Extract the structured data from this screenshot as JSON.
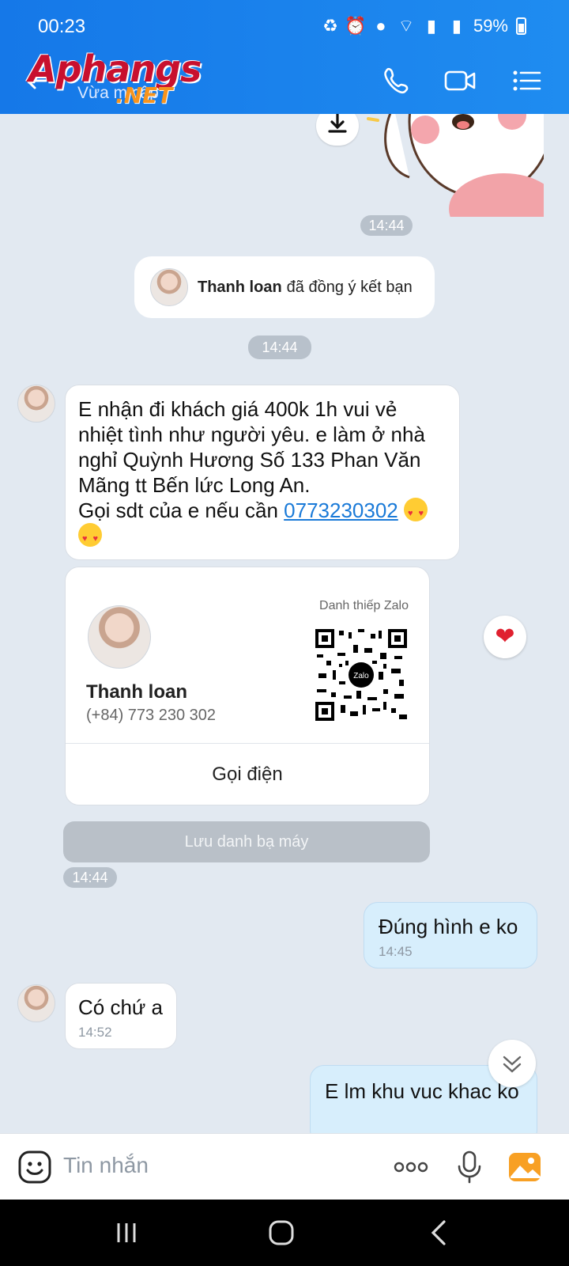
{
  "status_bar": {
    "time": "00:23",
    "battery": "59%"
  },
  "header": {
    "logo_main": "Aphangs",
    "logo_net": ".NET",
    "subtitle": "Vừa m   cập"
  },
  "chat": {
    "time_1": "14:44",
    "system_message": {
      "name": "Thanh loan",
      "text": "đã đồng ý kết bạn"
    },
    "time_2": "14:44",
    "incoming_1": {
      "line_1": "E   nhận đi khách giá 400k 1h vui vẻ",
      "line_2": "nhiệt tình như người yêu. e làm ở nhà",
      "line_3": "nghỉ Quỳnh Hương Số 133 Phan Văn",
      "line_4": "Mãng tt Bến lức Long An.",
      "line_5_prefix": "Gọi sdt của e nếu cần ",
      "phone_link": "0773230302"
    },
    "contact_card": {
      "label": "Danh thiếp Zalo",
      "name": "Thanh loan",
      "phone": "(+84) 773 230 302",
      "call_label": "Gọi điện",
      "qr_badge": "Zalo"
    },
    "save_contact_label": "Lưu danh bạ máy",
    "time_3": "14:44",
    "outgoing_1": {
      "text": "Đúng  hình e ko",
      "time": "14:45"
    },
    "incoming_2": {
      "text": "Có chứ a",
      "time": "14:52"
    },
    "outgoing_2": {
      "text": "E lm khu vuc khac ko"
    }
  },
  "input": {
    "placeholder": "Tin nhắn"
  },
  "icons": [
    "back-arrow-icon",
    "phone-icon",
    "video-icon",
    "menu-icon",
    "download-icon",
    "heart-icon",
    "chevron-down-icon",
    "sticker-icon",
    "more-icon",
    "mic-icon",
    "image-icon",
    "recents-icon",
    "home-icon",
    "nav-back-icon"
  ],
  "colors": {
    "header": "#1a82ec",
    "chat_bg": "#e2e9f1",
    "outgoing_bubble": "#d7eefc",
    "link": "#1a7ad8",
    "heart": "#e0202f"
  }
}
